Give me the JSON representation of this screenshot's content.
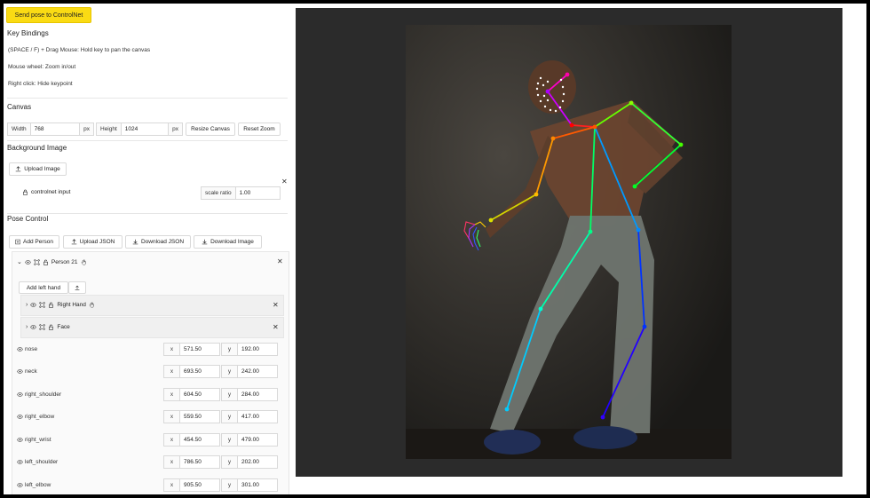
{
  "toolbar": {
    "send_label": "Send pose to ControlNet"
  },
  "key_bindings": {
    "title": "Key Bindings",
    "lines": [
      "(SPACE / F) + Drag Mouse: Hold key to pan the canvas",
      "Mouse wheel: Zoom in/out",
      "Right click: Hide keypoint"
    ]
  },
  "canvas": {
    "title": "Canvas",
    "width_label": "Width",
    "width_value": "768",
    "width_unit": "px",
    "height_label": "Height",
    "height_value": "1024",
    "height_unit": "px",
    "resize_label": "Resize Canvas",
    "reset_zoom_label": "Reset Zoom"
  },
  "background": {
    "title": "Background Image",
    "upload_label": "Upload Image",
    "input_name": "controlnet input",
    "scale_label": "scale ratio",
    "scale_value": "1.00"
  },
  "pose_control": {
    "title": "Pose Control",
    "add_person": "Add Person",
    "upload_json": "Upload JSON",
    "download_json": "Download JSON",
    "download_image": "Download Image"
  },
  "person": {
    "name": "Person 21",
    "add_left_hand": "Add left hand",
    "right_hand": "Right Hand",
    "face": "Face"
  },
  "keypoints": [
    {
      "name": "nose",
      "x": "571.50",
      "y": "192.00"
    },
    {
      "name": "neck",
      "x": "693.50",
      "y": "242.00"
    },
    {
      "name": "right_shoulder",
      "x": "604.50",
      "y": "284.00"
    },
    {
      "name": "right_elbow",
      "x": "559.50",
      "y": "417.00"
    },
    {
      "name": "right_wrist",
      "x": "454.50",
      "y": "479.00"
    },
    {
      "name": "left_shoulder",
      "x": "786.50",
      "y": "202.00"
    },
    {
      "name": "left_elbow",
      "x": "905.50",
      "y": "301.00"
    }
  ],
  "axis_labels": {
    "x": "x",
    "y": "y"
  },
  "colors": {
    "send_button": "#fadb14",
    "canvas_bg": "#2b2b2b"
  }
}
